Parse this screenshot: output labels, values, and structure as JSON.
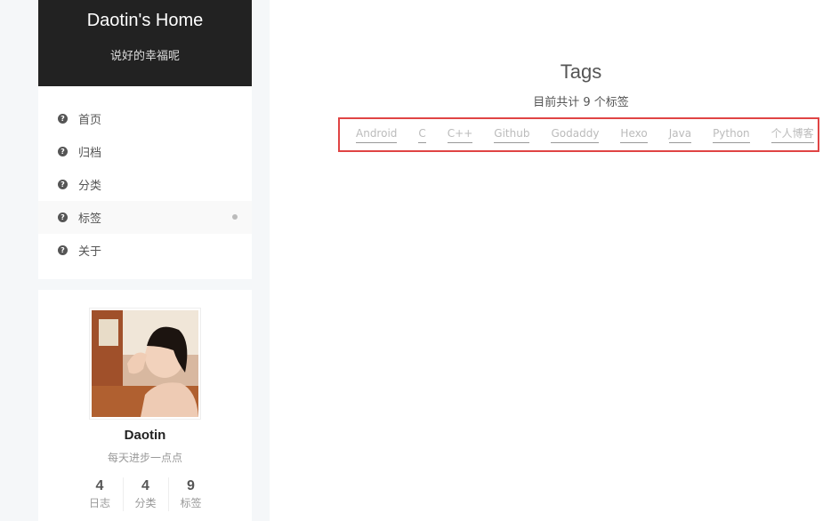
{
  "site": {
    "title": "Daotin's Home",
    "subtitle": "说好的幸福呢"
  },
  "menu": {
    "items": [
      {
        "label": "首页",
        "icon": "question-circle-icon"
      },
      {
        "label": "归档",
        "icon": "question-circle-icon"
      },
      {
        "label": "分类",
        "icon": "question-circle-icon"
      },
      {
        "label": "标签",
        "icon": "question-circle-icon",
        "active": true
      },
      {
        "label": "关于",
        "icon": "question-circle-icon"
      }
    ]
  },
  "author": {
    "name": "Daotin",
    "motto": "每天进步一点点",
    "stats": [
      {
        "count": "4",
        "label": "日志"
      },
      {
        "count": "4",
        "label": "分类"
      },
      {
        "count": "9",
        "label": "标签"
      }
    ]
  },
  "tags_page": {
    "title": "Tags",
    "summary": "目前共计 9 个标签",
    "tags": [
      "Android",
      "C",
      "C++",
      "Github",
      "Godaddy",
      "Hexo",
      "Java",
      "Python",
      "个人博客"
    ]
  },
  "colors": {
    "sidebar_header": "#222222",
    "highlight_border": "#e04444",
    "tag_text": "#bbbbbb"
  }
}
